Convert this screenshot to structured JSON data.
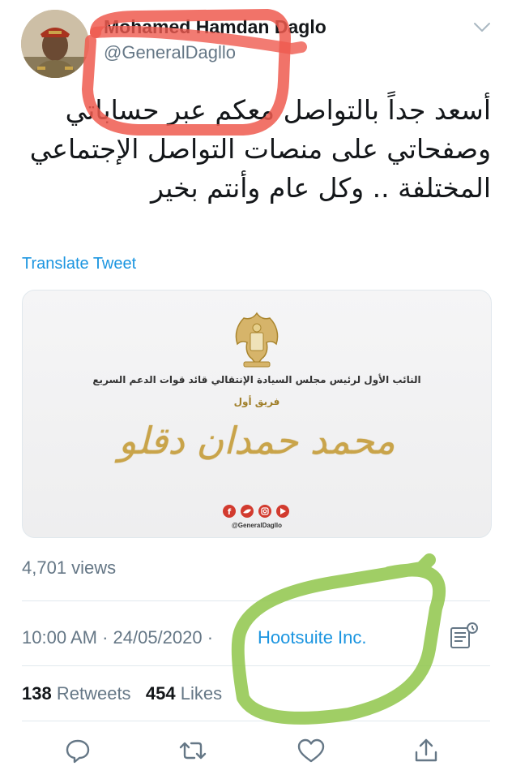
{
  "user": {
    "name": "Mohamed Hamdan Daglo",
    "handle": "@GeneralDagllo"
  },
  "tweet": {
    "text_lines": [
      "أسعد جداً بالتواصل معكم عبر حساباتي",
      "وصفحاتي على منصات التواصل الإجتماعي",
      "المختلفة .. وكل عام وأنتم بخير"
    ],
    "translate_label": "Translate Tweet"
  },
  "media": {
    "title_line": "النائب الأول لرئيس مجلس السيادة الإنتقالي قائد قوات الدعم السريع",
    "rank_line": "فريق أول",
    "calligraphy": "محمد حمدان دقلو",
    "social_handle": "@GeneralDagllo"
  },
  "views": "4,701 views",
  "meta": {
    "timestamp": "10:00 AM · 24/05/2020 ·",
    "source": "Hootsuite Inc."
  },
  "stats": {
    "retweets_count": "138",
    "retweets_label": "Retweets",
    "likes_count": "454",
    "likes_label": "Likes"
  },
  "icons": {
    "more": "chevron-down-icon",
    "analytics": "analytics-icon",
    "reply": "reply-icon",
    "retweet": "retweet-icon",
    "like": "heart-icon",
    "share": "share-icon"
  },
  "colors": {
    "link": "#1b95e0",
    "secondary_text": "#657786",
    "red_annotation": "#ef5a4f",
    "green_annotation": "#8fc64a"
  }
}
